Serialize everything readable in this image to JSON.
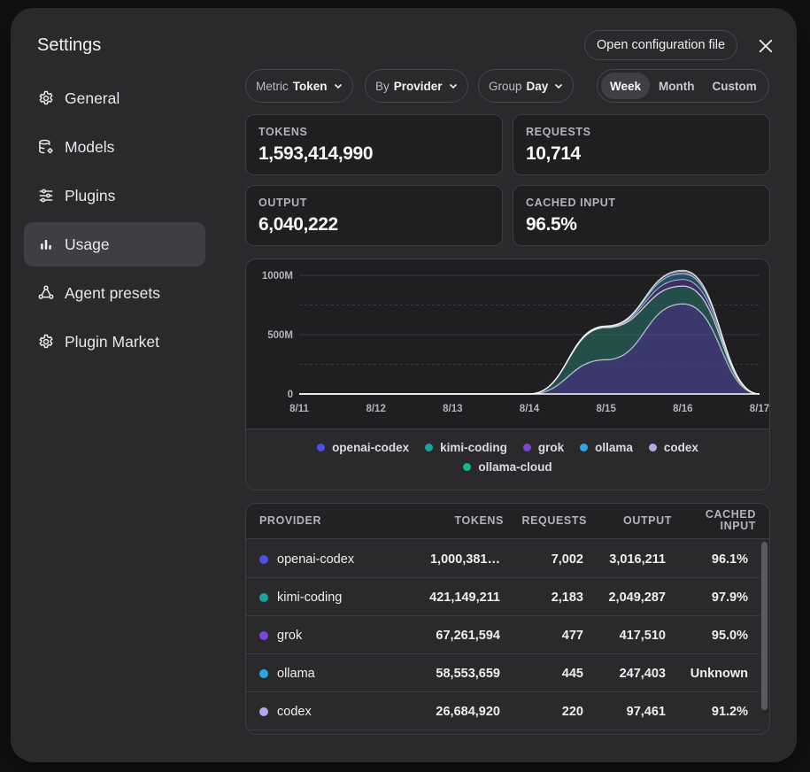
{
  "dialog": {
    "title": "Settings"
  },
  "sidebar": {
    "items": [
      {
        "label": "General",
        "icon": "gear-icon"
      },
      {
        "label": "Models",
        "icon": "database-gear-icon"
      },
      {
        "label": "Plugins",
        "icon": "sliders-icon"
      },
      {
        "label": "Usage",
        "icon": "bar-chart-icon",
        "active": true
      },
      {
        "label": "Agent presets",
        "icon": "agent-network-icon"
      },
      {
        "label": "Plugin Market",
        "icon": "gear-icon"
      }
    ]
  },
  "header": {
    "open_config_label": "Open configuration file"
  },
  "filters": {
    "metric": {
      "prefix": "Metric",
      "value": "Token"
    },
    "by": {
      "prefix": "By",
      "value": "Provider"
    },
    "group": {
      "prefix": "Group",
      "value": "Day"
    },
    "range": {
      "options": [
        "Week",
        "Month",
        "Custom"
      ],
      "selected": "Week"
    }
  },
  "stats": {
    "tokens": {
      "label": "TOKENS",
      "value": "1,593,414,990"
    },
    "requests": {
      "label": "REQUESTS",
      "value": "10,714"
    },
    "output": {
      "label": "OUTPUT",
      "value": "6,040,222"
    },
    "cached_input": {
      "label": "CACHED INPUT",
      "value": "96.5%"
    }
  },
  "colors": {
    "openai-codex": "#4a4fe6",
    "kimi-coding": "#16a5a0",
    "grok": "#7b45d9",
    "ollama": "#2aa7e8",
    "codex": "#b4a8f0",
    "ollama-cloud": "#14b885"
  },
  "chart_data": {
    "type": "area",
    "stacked": true,
    "x": [
      "8/11",
      "8/12",
      "8/13",
      "8/14",
      "8/15",
      "8/16",
      "8/17"
    ],
    "yticks": [
      "1000M",
      "500M",
      "0"
    ],
    "ylim": [
      0,
      1000
    ],
    "yunit": "M",
    "series": [
      {
        "name": "openai-codex",
        "values": [
          0,
          0,
          0,
          0,
          290,
          760,
          0
        ]
      },
      {
        "name": "kimi-coding",
        "values": [
          0,
          0,
          0,
          0,
          270,
          150,
          0
        ]
      },
      {
        "name": "grok",
        "values": [
          0,
          0,
          0,
          0,
          5,
          55,
          0
        ]
      },
      {
        "name": "ollama",
        "values": [
          0,
          0,
          0,
          0,
          4,
          50,
          0
        ]
      },
      {
        "name": "codex",
        "values": [
          0,
          0,
          0,
          0,
          3,
          20,
          0
        ]
      },
      {
        "name": "ollama-cloud",
        "values": [
          0,
          0,
          0,
          0,
          2,
          8,
          0
        ]
      }
    ],
    "legend": [
      "openai-codex",
      "kimi-coding",
      "grok",
      "ollama",
      "codex",
      "ollama-cloud"
    ],
    "legend_position": "bottom",
    "grid": true
  },
  "table": {
    "columns": [
      "PROVIDER",
      "TOKENS",
      "REQUESTS",
      "OUTPUT",
      "CACHED INPUT"
    ],
    "rows": [
      {
        "provider": "openai-codex",
        "tokens": "1,000,381…",
        "requests": "7,002",
        "output": "3,016,211",
        "cached": "96.1%"
      },
      {
        "provider": "kimi-coding",
        "tokens": "421,149,211",
        "requests": "2,183",
        "output": "2,049,287",
        "cached": "97.9%"
      },
      {
        "provider": "grok",
        "tokens": "67,261,594",
        "requests": "477",
        "output": "417,510",
        "cached": "95.0%"
      },
      {
        "provider": "ollama",
        "tokens": "58,553,659",
        "requests": "445",
        "output": "247,403",
        "cached": "Unknown"
      },
      {
        "provider": "codex",
        "tokens": "26,684,920",
        "requests": "220",
        "output": "97,461",
        "cached": "91.2%"
      }
    ]
  }
}
